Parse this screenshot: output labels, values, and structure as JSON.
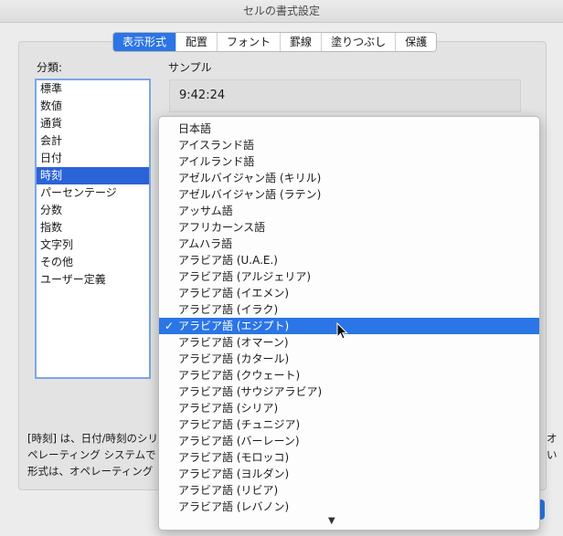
{
  "window": {
    "title": "セルの書式設定"
  },
  "tabs": [
    {
      "label": "表示形式",
      "active": true
    },
    {
      "label": "配置",
      "active": false
    },
    {
      "label": "フォント",
      "active": false
    },
    {
      "label": "罫線",
      "active": false
    },
    {
      "label": "塗りつぶし",
      "active": false
    },
    {
      "label": "保護",
      "active": false
    }
  ],
  "category": {
    "label": "分類:",
    "items": [
      "標準",
      "数値",
      "通貨",
      "会計",
      "日付",
      "時刻",
      "パーセンテージ",
      "分数",
      "指数",
      "文字列",
      "その他",
      "ユーザー定義"
    ],
    "selected_index": 5
  },
  "sample": {
    "label": "サンプル",
    "value": "9:42:24"
  },
  "description": {
    "line1_left": "[時刻] は、日付/時刻のシリ",
    "line1_right": "オ",
    "line2_left": "ペレーティング システムで",
    "line2_right": "い",
    "line3_left": "形式は、オペレーティング"
  },
  "locale_dropdown": {
    "items": [
      "日本語",
      "アイスランド語",
      "アイルランド語",
      "アゼルバイジャン語 (キリル)",
      "アゼルバイジャン語 (ラテン)",
      "アッサム語",
      "アフリカーンス語",
      "アムハラ語",
      "アラビア語 (U.A.E.)",
      "アラビア語 (アルジェリア)",
      "アラビア語 (イエメン)",
      "アラビア語 (イラク)",
      "アラビア語 (エジプト)",
      "アラビア語 (オマーン)",
      "アラビア語 (カタール)",
      "アラビア語 (クウェート)",
      "アラビア語 (サウジアラビア)",
      "アラビア語 (シリア)",
      "アラビア語 (チュニジア)",
      "アラビア語 (バーレーン)",
      "アラビア語 (モロッコ)",
      "アラビア語 (ヨルダン)",
      "アラビア語 (リビア)",
      "アラビア語 (レバノン)"
    ],
    "selected_index": 12,
    "check_glyph": "✓",
    "scroll_indicator_glyph": "▼"
  },
  "colors": {
    "accent": "#2b75e6",
    "list_selection": "#2b63d9"
  }
}
